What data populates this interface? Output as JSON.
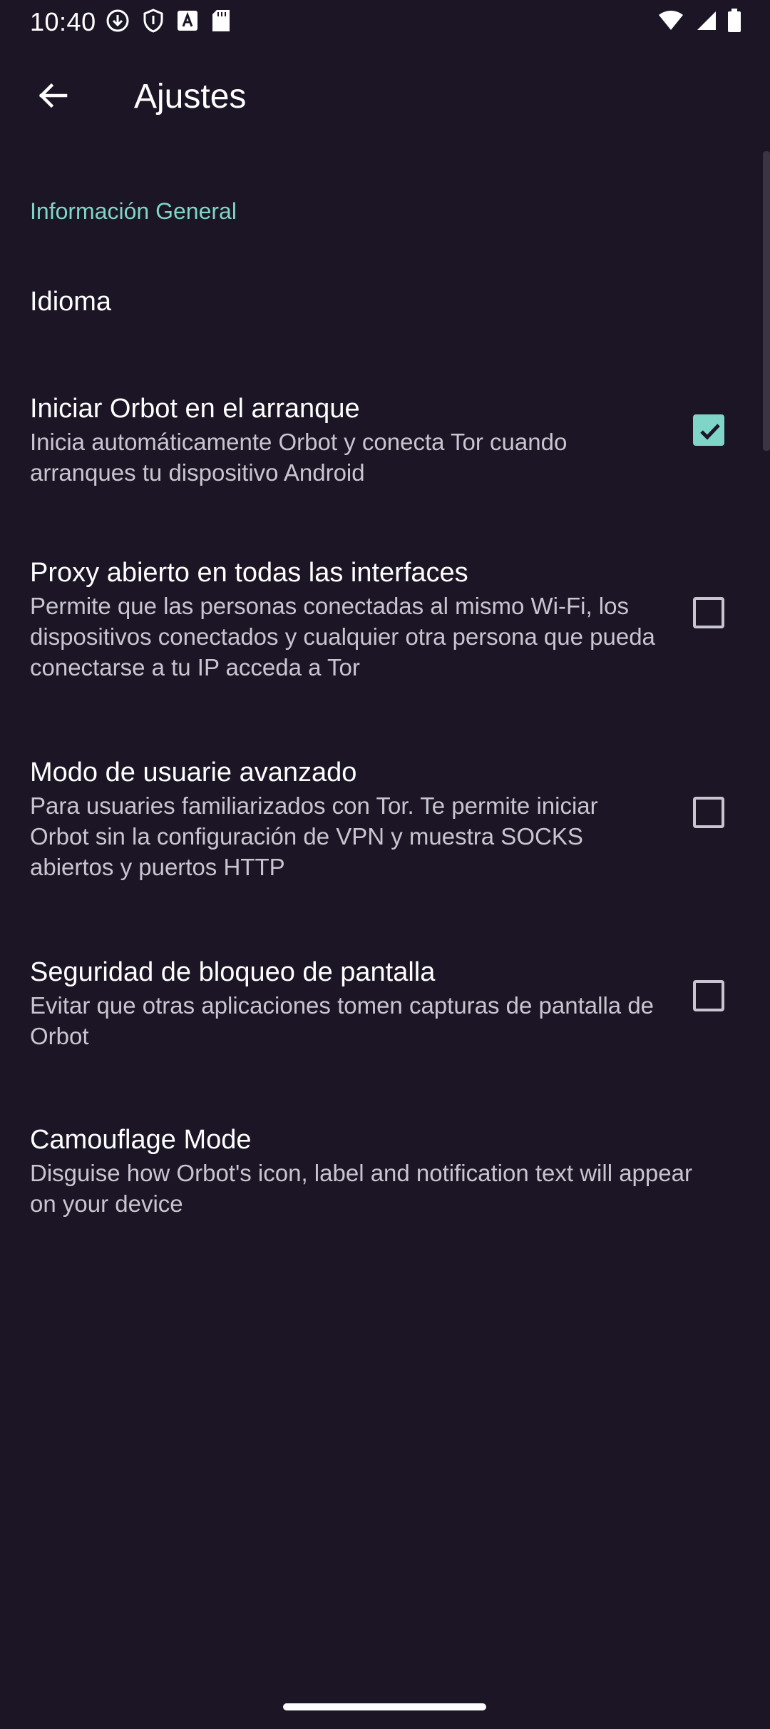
{
  "status_bar": {
    "time": "10:40",
    "left_icons": [
      "download-icon",
      "shield-icon",
      "app-a-icon",
      "sd-card-icon"
    ],
    "right_icons": [
      "wifi-icon",
      "cellular-signal-icon",
      "battery-icon"
    ]
  },
  "app_bar": {
    "title": "Ajustes"
  },
  "section": {
    "header": "Información General"
  },
  "prefs": [
    {
      "title": "Idioma",
      "summary": "",
      "checkbox": null
    },
    {
      "title": "Iniciar Orbot en el arranque",
      "summary": "Inicia automáticamente Orbot y conecta Tor cuando arranques tu dispositivo Android",
      "checkbox": true
    },
    {
      "title": "Proxy abierto en todas las interfaces",
      "summary": "Permite que las personas conectadas al mismo Wi-Fi, los dispositivos conectados y cualquier otra persona que pueda conectarse a tu IP acceda a Tor",
      "checkbox": false
    },
    {
      "title": "Modo de usuarie avanzado",
      "summary": "Para usuaries familiarizados con Tor. Te permite iniciar Orbot sin la configuración de VPN y muestra SOCKS abiertos y puertos HTTP",
      "checkbox": false
    },
    {
      "title": "Seguridad de bloqueo de pantalla",
      "summary": "Evitar que otras aplicaciones tomen capturas de pantalla de Orbot",
      "checkbox": false
    },
    {
      "title": "Camouflage Mode",
      "summary": "Disguise how Orbot's icon, label and notification text will appear on your device",
      "checkbox": null
    }
  ],
  "colors": {
    "background": "#1c1525",
    "accent": "#7fd6c8",
    "summary_text": "#c9c5d0"
  }
}
